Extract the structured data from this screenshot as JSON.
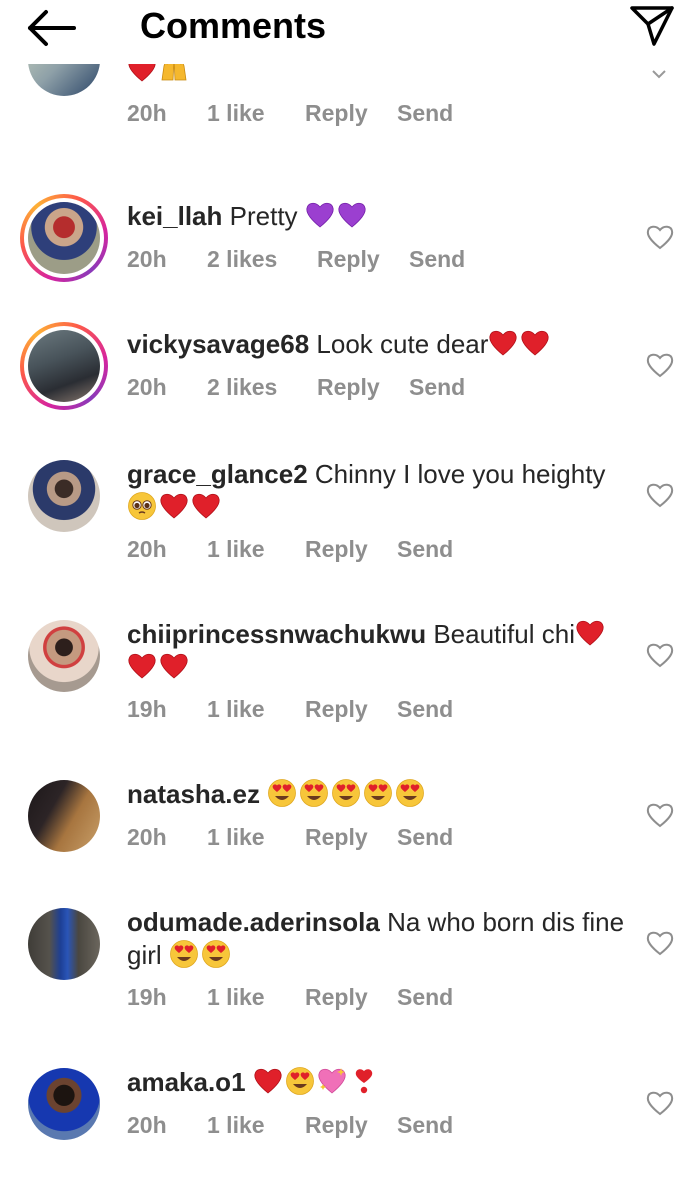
{
  "header": {
    "title": "Comments"
  },
  "comments": [
    {
      "username": "",
      "text": "",
      "time": "20h",
      "likes": "1 like",
      "reply": "Reply",
      "send": "Send",
      "emojis": [
        "red-heart",
        "raised-hands"
      ],
      "avatar_colors": [
        "#b8c5b0",
        "#35506e"
      ]
    },
    {
      "username": "kei_llah",
      "text": "Pretty",
      "time": "20h",
      "likes": "2 likes",
      "reply": "Reply",
      "send": "Send",
      "emojis": [
        "purple-heart",
        "purple-heart"
      ],
      "avatar_colors": [
        "#a9a88f",
        "#b0202a"
      ]
    },
    {
      "username": "vickysavage68",
      "text": "Look cute dear",
      "time": "20h",
      "likes": "2 likes",
      "reply": "Reply",
      "send": "Send",
      "emojis": [
        "red-heart",
        "red-heart"
      ],
      "avatar_colors": [
        "#5c6a6e",
        "#2b2f35"
      ]
    },
    {
      "username": "grace_glance2",
      "text": "Chinny I love you heighty",
      "time": "20h",
      "likes": "1 like",
      "reply": "Reply",
      "send": "Send",
      "emojis": [
        "pleading-face",
        "red-heart",
        "red-heart"
      ],
      "avatar_colors": [
        "#c9c0b6",
        "#27386b"
      ]
    },
    {
      "username": "chiiprincessnwachukwu",
      "text": "Beautiful chi",
      "time": "19h",
      "likes": "1 like",
      "reply": "Reply",
      "send": "Send",
      "emojis": [
        "red-heart",
        "red-heart",
        "red-heart"
      ],
      "avatar_colors": [
        "#d9b5a3",
        "#3a2a24"
      ]
    },
    {
      "username": "natasha.ez",
      "text": "",
      "time": "20h",
      "likes": "1 like",
      "reply": "Reply",
      "send": "Send",
      "emojis": [
        "heart-eyes",
        "heart-eyes",
        "heart-eyes",
        "heart-eyes",
        "heart-eyes"
      ],
      "avatar_colors": [
        "#9a6f44",
        "#1e1a1c"
      ]
    },
    {
      "username": "odumade.aderinsola",
      "text": "Na who born dis fine girl",
      "time": "19h",
      "likes": "1 like",
      "reply": "Reply",
      "send": "Send",
      "emojis": [
        "heart-eyes",
        "heart-eyes"
      ],
      "avatar_colors": [
        "#4d4a44",
        "#1f3f8c"
      ]
    },
    {
      "username": "amaka.o1",
      "text": "",
      "time": "20h",
      "likes": "1 like",
      "reply": "Reply",
      "send": "Send",
      "emojis": [
        "red-heart",
        "heart-eyes",
        "sparkling-heart",
        "exclamation-heart"
      ],
      "avatar_colors": [
        "#3f5f9a",
        "#1432a8"
      ]
    }
  ],
  "colors": {
    "accent_story": "#d6249f",
    "meta_gray": "#8e8e8e",
    "text": "#262626"
  }
}
